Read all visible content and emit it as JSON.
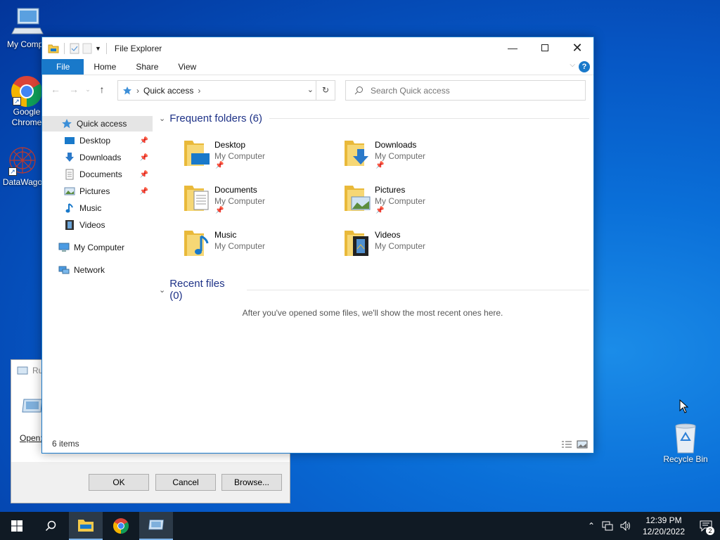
{
  "desktop": {
    "icons": [
      {
        "name": "my-computer",
        "label": "My Compu"
      },
      {
        "name": "google-chrome",
        "label": "Google Chrome"
      },
      {
        "name": "datawagon",
        "label": "DataWago"
      },
      {
        "name": "recycle-bin",
        "label": "Recycle Bin"
      }
    ]
  },
  "run_dialog": {
    "title": "Ru",
    "open_label": "Open:",
    "ok": "OK",
    "cancel": "Cancel",
    "browse": "Browse..."
  },
  "explorer": {
    "title": "File Explorer",
    "ribbon_tabs": [
      "File",
      "Home",
      "Share",
      "View"
    ],
    "address": "Quick access",
    "search_placeholder": "Search Quick access",
    "nav": {
      "quick_access": "Quick access",
      "items": [
        "Desktop",
        "Downloads",
        "Documents",
        "Pictures",
        "Music",
        "Videos"
      ],
      "my_computer": "My Computer",
      "network": "Network"
    },
    "frequent_header": "Frequent folders (6)",
    "folders": [
      {
        "name": "Desktop",
        "location": "My Computer"
      },
      {
        "name": "Downloads",
        "location": "My Computer"
      },
      {
        "name": "Documents",
        "location": "My Computer"
      },
      {
        "name": "Pictures",
        "location": "My Computer"
      },
      {
        "name": "Music",
        "location": "My Computer"
      },
      {
        "name": "Videos",
        "location": "My Computer"
      }
    ],
    "recent_header": "Recent files (0)",
    "recent_empty": "After you've opened some files, we'll show the most recent ones here.",
    "status": "6 items"
  },
  "taskbar": {
    "time": "12:39 PM",
    "date": "12/20/2022",
    "notification_count": "2"
  },
  "colors": {
    "accent": "#1979ca",
    "folder_yellow": "#f3c94a",
    "taskbar": "#101a24"
  }
}
